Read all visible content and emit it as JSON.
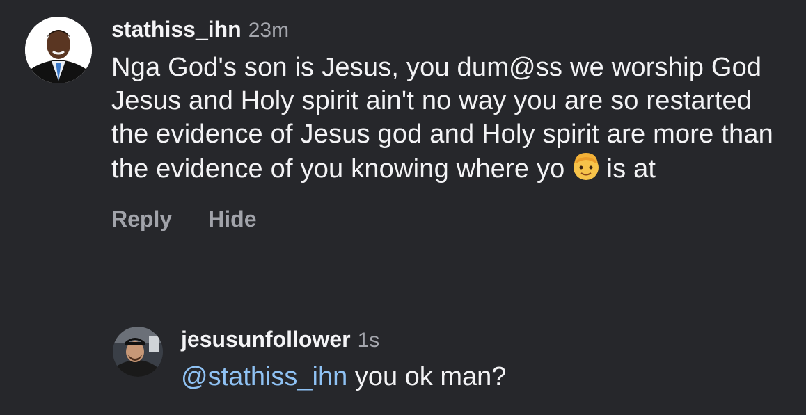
{
  "comment_main": {
    "username": "stathiss_ihn",
    "time": "23m",
    "text_before_emoji": "Nga God's son is Jesus, you dum@ss we worship God Jesus and Holy spirit ain't no way you are so restarted the evidence of Jesus god and Holy spirit are more than the evidence of you knowing where yo",
    "emoji": "man-emoji",
    "text_after_emoji": "is at",
    "actions": {
      "reply": "Reply",
      "hide": "Hide"
    }
  },
  "reply": {
    "username": "jesusunfollower",
    "time": "1s",
    "mention": "@stathiss_ihn",
    "text": "you ok man?"
  },
  "colors": {
    "background": "#26272b",
    "mention": "#8fc2f4",
    "muted": "#a1a3aa"
  }
}
